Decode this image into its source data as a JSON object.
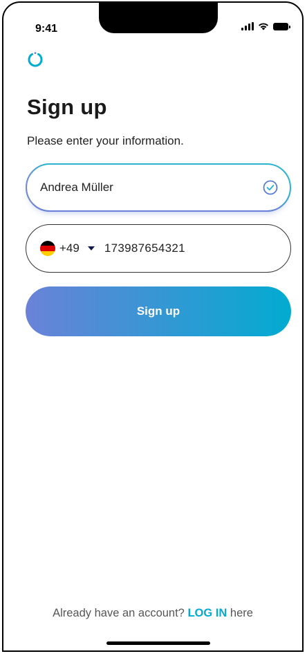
{
  "status_bar": {
    "time": "9:41"
  },
  "header": {
    "title": "Sign up",
    "subtitle": "Please enter your information."
  },
  "form": {
    "name_value": "Andrea Müller",
    "country_dial_code": "+49",
    "country_flag": "germany-flag-icon",
    "phone_number": "173987654321",
    "submit_label": "Sign up"
  },
  "footer": {
    "prefix": "Already have an account?",
    "link_label": "LOG IN",
    "suffix": "here"
  },
  "colors": {
    "accent": "#02abd1",
    "gradient_start": "#6a82d8",
    "gradient_end": "#02abd1"
  }
}
